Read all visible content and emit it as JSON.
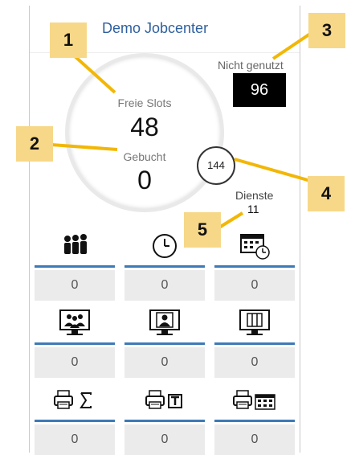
{
  "header": {
    "title": "Demo Jobcenter"
  },
  "gauge": {
    "free_label": "Freie Slots",
    "free_value": "48",
    "booked_label": "Gebucht",
    "booked_value": "0"
  },
  "not_used": {
    "label": "Nicht genutzt",
    "value": "96"
  },
  "total_badge": {
    "value": "144"
  },
  "services": {
    "label": "Dienste",
    "value": "11"
  },
  "tiles": [
    {
      "icon": "group-icon",
      "value": "0"
    },
    {
      "icon": "clock-icon",
      "value": "0"
    },
    {
      "icon": "calendar-clock-icon",
      "value": "0"
    },
    {
      "icon": "monitor-group-icon",
      "value": "0"
    },
    {
      "icon": "monitor-person-icon",
      "value": "0"
    },
    {
      "icon": "monitor-columns-icon",
      "value": "0"
    },
    {
      "icon": "printer-sum-icon",
      "value": "0"
    },
    {
      "icon": "printer-t-icon",
      "value": "0"
    },
    {
      "icon": "printer-calendar-icon",
      "value": "0"
    }
  ],
  "callouts": [
    "1",
    "2",
    "3",
    "4",
    "5"
  ],
  "colors": {
    "accent": "#3d7ab7",
    "title": "#2e5f9e",
    "callout": "#f7d889"
  }
}
